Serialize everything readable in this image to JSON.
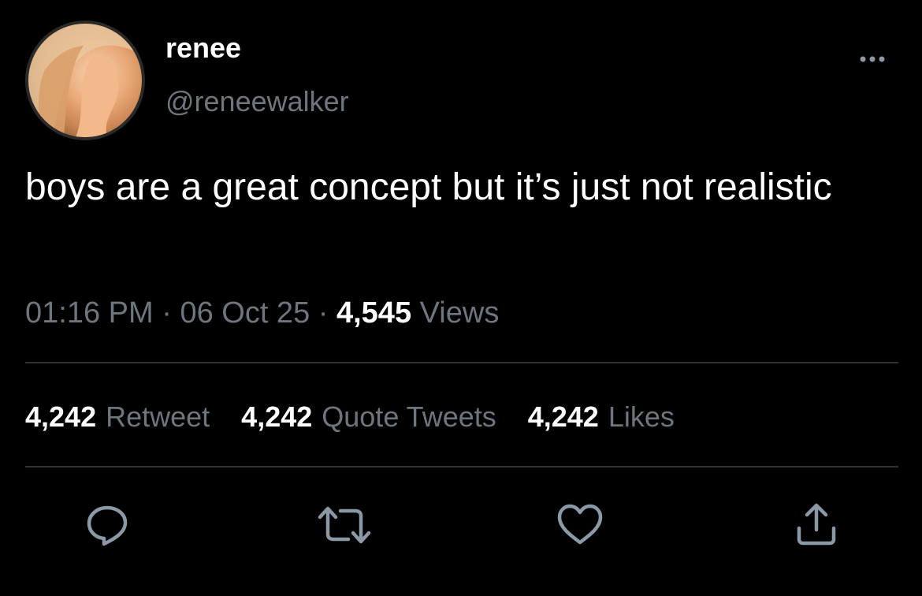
{
  "user": {
    "display_name": "renee",
    "handle": "@reneewalker"
  },
  "tweet": {
    "text": "boys are a great concept but it’s just not realistic",
    "time": "01:16 PM",
    "separator1": "·",
    "date": "06 Oct 25",
    "separator2": "·",
    "views_count": "4,545",
    "views_label": "Views"
  },
  "stats": {
    "retweets_count": "4,242",
    "retweets_label": "Retweet",
    "quotes_count": "4,242",
    "quotes_label": "Quote Tweets",
    "likes_count": "4,242",
    "likes_label": "Likes"
  },
  "icons": {
    "more": "more-horizontal-icon",
    "reply": "reply-icon",
    "retweet": "retweet-icon",
    "like": "heart-icon",
    "share": "share-icon"
  },
  "colors": {
    "background": "#000000",
    "secondary_text": "#6e767d",
    "icon": "#8b98a5",
    "divider": "#2f3336"
  }
}
